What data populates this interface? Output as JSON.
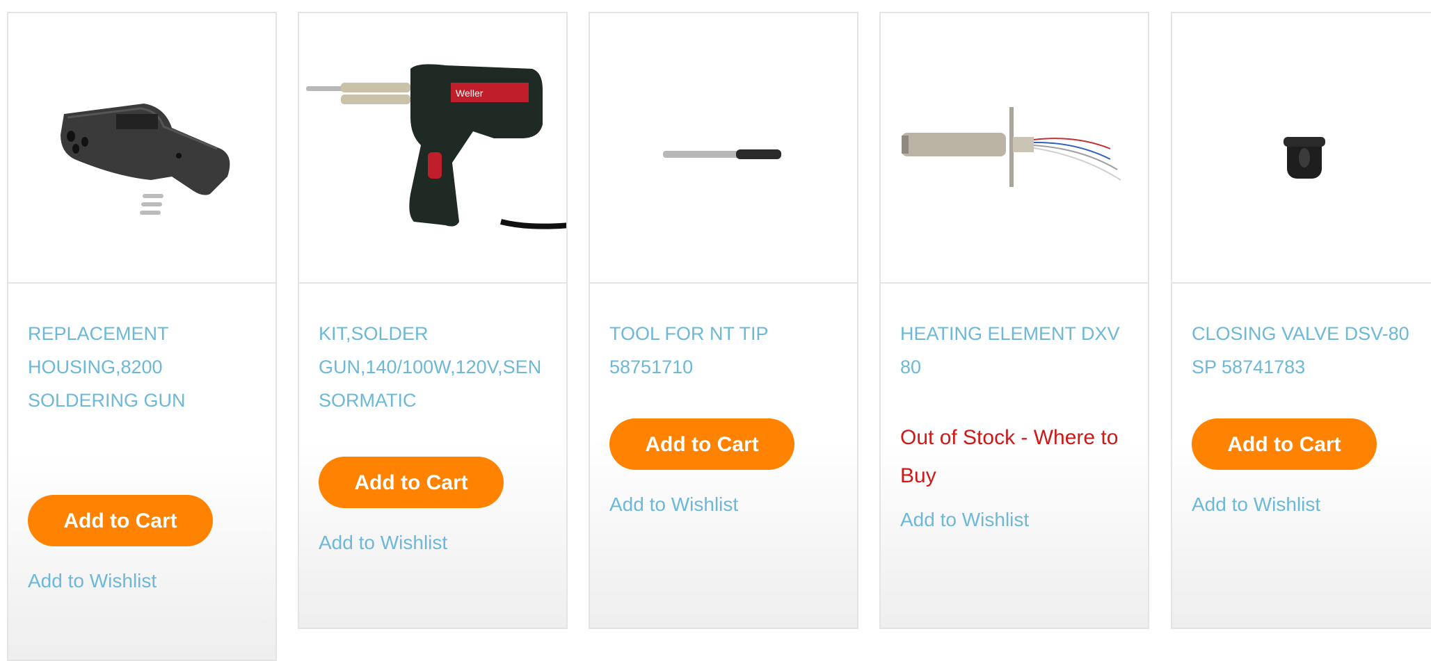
{
  "products": [
    {
      "title": "REPLACEMENT HOUSING,8200 SOLDERING GUN",
      "image": "housing-image",
      "cart_label": "Add to Cart",
      "wishlist_label": "Add to Wishlist"
    },
    {
      "title": "KIT,SOLDER GUN,140/100W,120V,SENSORMATIC",
      "image": "soldering-gun-image",
      "cart_label": "Add to Cart",
      "wishlist_label": "Add to Wishlist"
    },
    {
      "title": "TOOL FOR NT TIP 58751710",
      "image": "tip-tool-image",
      "cart_label": "Add to Cart",
      "wishlist_label": "Add to Wishlist"
    },
    {
      "title": "HEATING ELEMENT DXV 80",
      "image": "heating-element-image",
      "stock_status": "Out of Stock - Where to Buy",
      "wishlist_label": "Add to Wishlist"
    },
    {
      "title": "CLOSING VALVE DSV-80 SP 58741783",
      "image": "closing-valve-image",
      "cart_label": "Add to Cart",
      "wishlist_label": "Add to Wishlist"
    }
  ],
  "colors": {
    "link": "#6cb8d6",
    "button": "#ff8200",
    "out_of_stock": "#d01818",
    "border": "#e4e4e4"
  }
}
